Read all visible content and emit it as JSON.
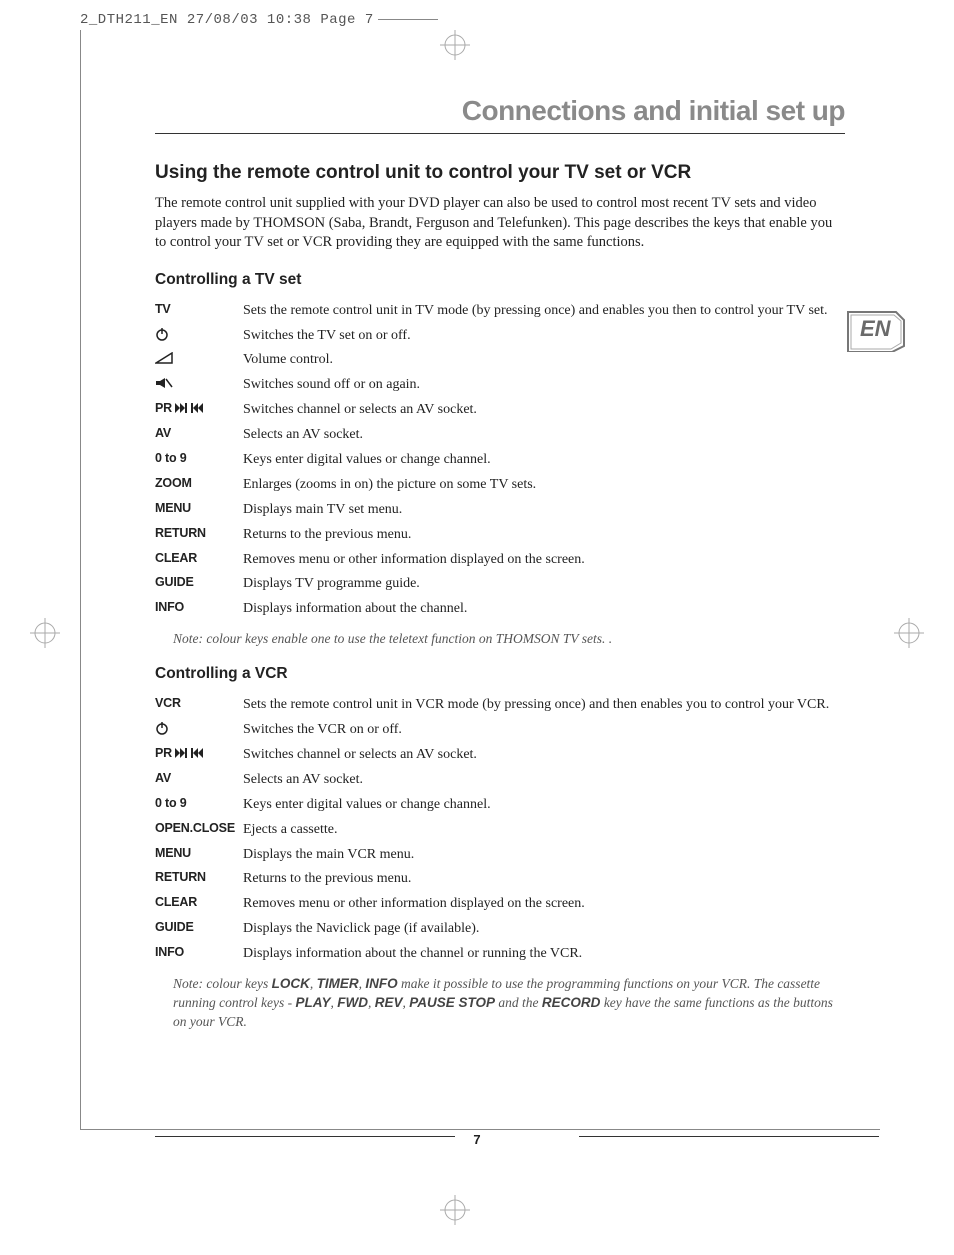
{
  "print_header": "2_DTH211_EN  27/08/03  10:38  Page 7",
  "lang_tab": "EN",
  "page_number": "7",
  "chapter_title": "Connections and initial set up",
  "section_title": "Using the remote control unit to control your TV set or VCR",
  "intro": "The remote control unit supplied with your DVD player can also be used to control most recent TV sets and video players made by THOMSON (Saba, Brandt, Ferguson and Telefunken). This page describes the keys that enable you to control your TV set or VCR providing they are equipped with the same functions.",
  "tv": {
    "title": "Controlling a TV set",
    "rows": [
      {
        "key": "TV",
        "icon": "",
        "desc": "Sets the remote control unit in TV mode (by pressing once) and enables you then to control your TV set."
      },
      {
        "key": "",
        "icon": "power",
        "desc": "Switches the TV set on or off."
      },
      {
        "key": "",
        "icon": "vol",
        "desc": "Volume control."
      },
      {
        "key": "",
        "icon": "mute",
        "desc": "Switches sound off or on again."
      },
      {
        "key": "PR",
        "icon": "skip",
        "desc": "Switches channel or selects an AV socket."
      },
      {
        "key": "AV",
        "icon": "",
        "desc": "Selects an AV socket."
      },
      {
        "key": "0 to 9",
        "icon": "",
        "desc": "Keys enter digital values or change channel."
      },
      {
        "key": "ZOOM",
        "icon": "",
        "desc": "Enlarges (zooms in on) the picture on some TV sets."
      },
      {
        "key": "MENU",
        "icon": "",
        "desc": "Displays main TV set menu."
      },
      {
        "key": "RETURN",
        "icon": "",
        "desc": "Returns to the previous menu."
      },
      {
        "key": "CLEAR",
        "icon": "",
        "desc": "Removes menu or other information displayed on the screen."
      },
      {
        "key": "GUIDE",
        "icon": "",
        "desc": "Displays TV programme guide."
      },
      {
        "key": "INFO",
        "icon": "",
        "desc": "Displays information about the channel."
      }
    ],
    "note": "Note: colour keys enable one to use the teletext function on THOMSON TV sets. ."
  },
  "vcr": {
    "title": "Controlling a VCR",
    "rows": [
      {
        "key": "VCR",
        "icon": "",
        "desc": "Sets the remote control unit in VCR mode (by pressing once) and then enables you to control your VCR."
      },
      {
        "key": "",
        "icon": "power",
        "desc": "Switches the VCR on or off."
      },
      {
        "key": "PR",
        "icon": "skip",
        "desc": "Switches channel or selects an AV socket."
      },
      {
        "key": "AV",
        "icon": "",
        "desc": "Selects an AV socket."
      },
      {
        "key": "0 to 9",
        "icon": "",
        "desc": "Keys enter digital values or change channel."
      },
      {
        "key": "OPEN.CLOSE",
        "icon": "",
        "desc": "Ejects a cassette."
      },
      {
        "key": "MENU",
        "icon": "",
        "desc": "Displays the main VCR menu."
      },
      {
        "key": "RETURN",
        "icon": "",
        "desc": "Returns to the previous menu."
      },
      {
        "key": "CLEAR",
        "icon": "",
        "desc": "Removes menu or other information displayed on the screen."
      },
      {
        "key": "GUIDE",
        "icon": "",
        "desc": "Displays the Naviclick page (if available)."
      },
      {
        "key": "INFO",
        "icon": "",
        "desc": "Displays information about the channel or running the VCR."
      }
    ],
    "note_parts": {
      "p1": "Note: colour keys ",
      "b1": "LOCK",
      "p2": ", ",
      "b2": "TIMER",
      "p3": ", ",
      "b3": "INFO",
      "p4": " make it possible to use the programming functions on your VCR. The cassette running control keys - ",
      "b4": "PLAY",
      "p5": ", ",
      "b5": "FWD",
      "p6": ", ",
      "b6": "REV",
      "p7": ", ",
      "b7": "PAUSE STOP",
      "p8": " and the ",
      "b8": "RECORD",
      "p9": " key have the same functions as the buttons on your VCR."
    }
  }
}
